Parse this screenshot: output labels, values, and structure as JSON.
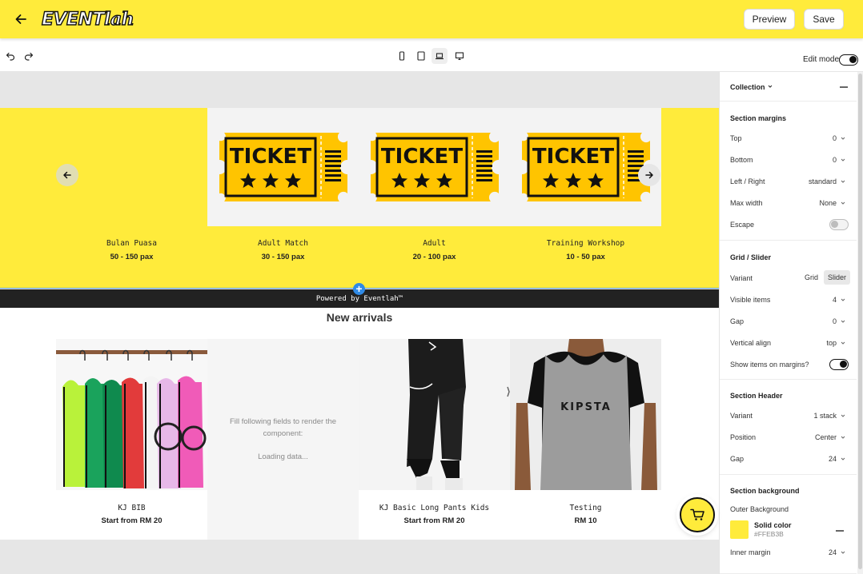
{
  "app": {
    "logo_text": "EVENT",
    "logo_suffix": "lah",
    "preview_label": "Preview",
    "save_label": "Save"
  },
  "toolbar": {
    "edit_mode_label": "Edit mode",
    "edit_mode_on": true,
    "active_device": "laptop-icon"
  },
  "collection_section": {
    "background_color": "#FFEB3B",
    "items": [
      {
        "title": "Bulan Puasa",
        "subtitle": "50 - 150 pax",
        "image": "none"
      },
      {
        "title": "Adult Match",
        "subtitle": "30 - 150 pax",
        "image": "ticket-icon"
      },
      {
        "title": "Adult",
        "subtitle": "20 - 100 pax",
        "image": "ticket-icon"
      },
      {
        "title": "Training Workshop",
        "subtitle": "10 - 50 pax",
        "image": "ticket-icon"
      }
    ],
    "ticket_text": "TICKET"
  },
  "powered_by": "Powered by Eventlah™",
  "arrivals_section": {
    "title": "New arrivals",
    "placeholder_text": "Fill following fields to render the component:",
    "loading_text": "Loading data...",
    "items": [
      {
        "title": "KJ BIB",
        "subtitle": "Start from RM 20",
        "image": "bibs-photo"
      },
      {
        "title": "",
        "subtitle": "",
        "image": "placeholder"
      },
      {
        "title": "KJ Basic Long Pants Kids",
        "subtitle": "Start from RM 20",
        "image": "pants-photo"
      },
      {
        "title": "Testing",
        "subtitle": "RM 10",
        "image": "kipsta-bib-photo"
      }
    ],
    "jersey_text": "KIPSTA"
  },
  "panel": {
    "title": "Collection",
    "section_margins": {
      "title": "Section margins",
      "rows": [
        {
          "label": "Top",
          "value": "0"
        },
        {
          "label": "Bottom",
          "value": "0"
        },
        {
          "label": "Left / Right",
          "value": "standard"
        },
        {
          "label": "Max width",
          "value": "None"
        }
      ],
      "escape_label": "Escape",
      "escape_on": false
    },
    "grid_slider": {
      "title": "Grid / Slider",
      "variant_label": "Variant",
      "variant_options": [
        "Grid",
        "Slider"
      ],
      "variant_selected": "Slider",
      "rows": [
        {
          "label": "Visible items",
          "value": "4"
        },
        {
          "label": "Gap",
          "value": "0"
        },
        {
          "label": "Vertical align",
          "value": "top"
        }
      ],
      "show_items_label": "Show items on margins?",
      "show_items_on": true
    },
    "section_header": {
      "title": "Section Header",
      "rows": [
        {
          "label": "Variant",
          "value": "1 stack"
        },
        {
          "label": "Position",
          "value": "Center"
        },
        {
          "label": "Gap",
          "value": "24"
        }
      ]
    },
    "section_background": {
      "title": "Section background",
      "outer_label": "Outer Background",
      "color_type": "Solid color",
      "color_hex": "#FFEB3B",
      "inner_margin_label": "Inner margin",
      "inner_margin_value": "24"
    }
  }
}
